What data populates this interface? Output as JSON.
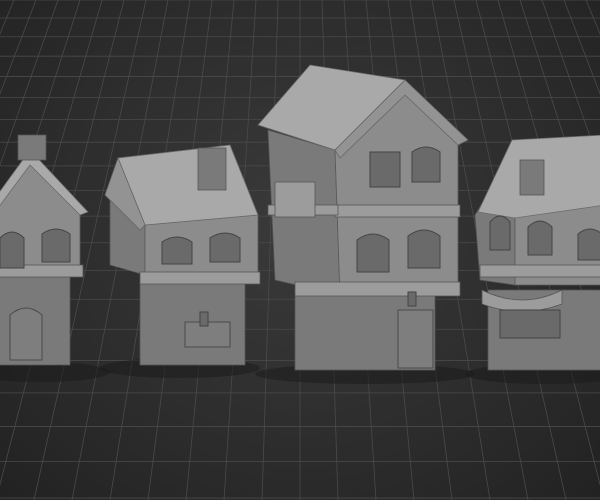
{
  "scene": {
    "description_type": "3d-wireframe-render",
    "house_count": 4,
    "colors": {
      "background": "#2b2b2b",
      "grid": "#4a4a4a",
      "model": "#8c8c8c",
      "roof": "#a9a9a9"
    }
  }
}
